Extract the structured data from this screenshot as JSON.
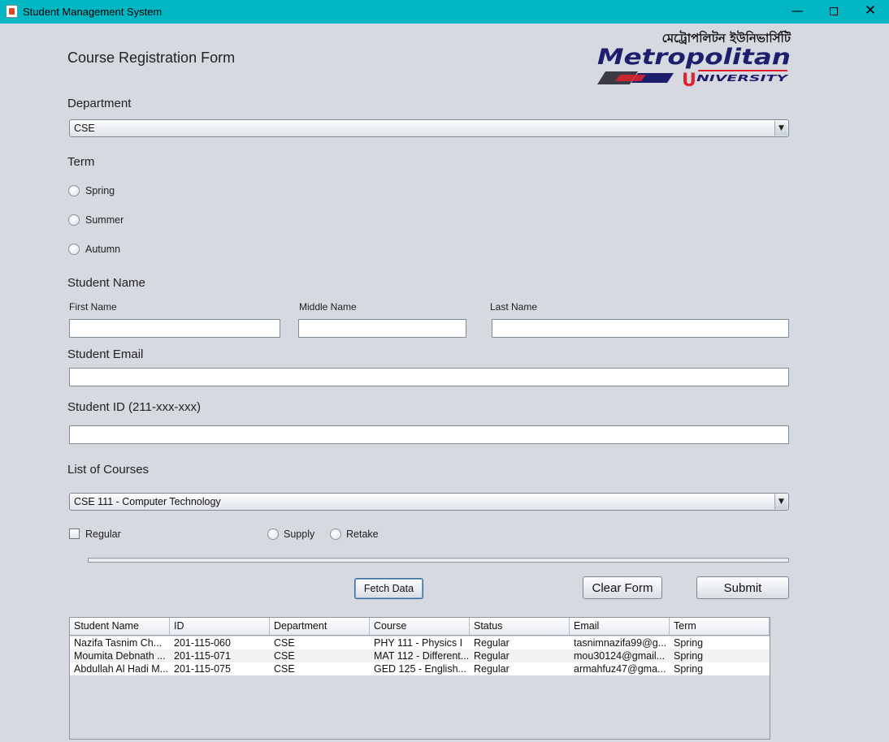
{
  "window": {
    "title": "Student Management System"
  },
  "form": {
    "heading": "Course Registration Form",
    "department": {
      "label": "Department",
      "selected": "CSE"
    },
    "term": {
      "label": "Term",
      "options": [
        "Spring",
        "Summer",
        "Autumn"
      ]
    },
    "student_name": {
      "label": "Student Name",
      "first_label": "First Name",
      "middle_label": "Middle Name",
      "last_label": "Last Name",
      "first_value": "",
      "middle_value": "",
      "last_value": ""
    },
    "email": {
      "label": "Student Email",
      "value": ""
    },
    "student_id": {
      "label": "Student ID (211-xxx-xxx)",
      "value": ""
    },
    "courses": {
      "label": "List of Courses",
      "selected": "CSE 111 - Computer Technology"
    },
    "status": {
      "regular": "Regular",
      "supply": "Supply",
      "retake": "Retake"
    },
    "buttons": {
      "fetch": "Fetch Data",
      "clear": "Clear Form",
      "submit": "Submit"
    }
  },
  "logo": {
    "bangla_text": "মেট্রোপলিটন ইউনিভার্সিটি",
    "name": "Metropolitan",
    "sub": "NIVERSITY",
    "initial": "U"
  },
  "table": {
    "columns": [
      "Student Name",
      "ID",
      "Department",
      "Course",
      "Status",
      "Email",
      "Term"
    ],
    "rows": [
      [
        "Nazifa Tasnim  Ch...",
        "201-115-060",
        "CSE",
        "PHY 111 - Physics I",
        "Regular",
        "tasnimnazifa99@g...",
        "Spring"
      ],
      [
        "Moumita Debnath ...",
        "201-115-071",
        "CSE",
        "MAT 112 - Different...",
        "Regular",
        "mou30124@gmail...",
        "Spring"
      ],
      [
        "Abdullah Al Hadi M...",
        "201-115-075",
        "CSE",
        "GED 125 - English...",
        "Regular",
        "armahfuz47@gma...",
        "Spring"
      ]
    ]
  },
  "colors": {
    "titlebar": "#00b7c3",
    "background": "#d6d9df",
    "logo_navy": "#1d1e6e",
    "logo_red": "#e0232e"
  }
}
